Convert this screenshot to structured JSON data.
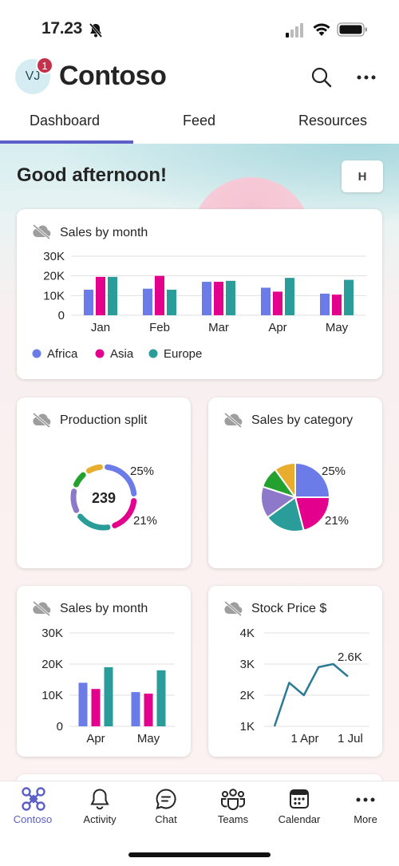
{
  "status_bar": {
    "time": "17.23"
  },
  "header": {
    "avatar_initials": "VJ",
    "badge_count": "1",
    "title": "Contoso"
  },
  "tabs": [
    {
      "label": "Dashboard",
      "selected": true
    },
    {
      "label": "Feed"
    },
    {
      "label": "Resources"
    }
  ],
  "greeting": "Good afternoon!",
  "hero_button_label": "H",
  "colors": {
    "accent": "#5b5fc7",
    "africa": "#6b7ce8",
    "asia": "#e3008c",
    "europe": "#2a9d9a",
    "line": "#2a7a94"
  },
  "cards": {
    "sales_month_big": {
      "title": "Sales by month"
    },
    "production_split": {
      "title": "Production split",
      "center_value": "239",
      "label_top": "25%",
      "label_bottom": "21%"
    },
    "sales_category": {
      "title": "Sales by category",
      "label_top": "25%",
      "label_bottom": "21%"
    },
    "sales_month_small": {
      "title": "Sales by month"
    },
    "stock_price": {
      "title": "Stock Price $",
      "annotation": "2.6K"
    }
  },
  "chart_data": [
    {
      "type": "bar",
      "title": "Sales by month",
      "categories": [
        "Jan",
        "Feb",
        "Mar",
        "Apr",
        "May"
      ],
      "series": [
        {
          "name": "Africa",
          "values": [
            13000,
            13500,
            17000,
            14000,
            11000
          ]
        },
        {
          "name": "Asia",
          "values": [
            19500,
            20000,
            17000,
            12000,
            10500
          ]
        },
        {
          "name": "Europe",
          "values": [
            19500,
            13000,
            17500,
            19000,
            18000
          ]
        }
      ],
      "yticks": [
        "0",
        "10K",
        "20K",
        "30K"
      ],
      "ylim": [
        0,
        30000
      ],
      "legend": "bottom-left"
    },
    {
      "type": "pie",
      "title": "Production split",
      "style": "donut",
      "center_label": "239",
      "slices": [
        {
          "value": 25,
          "color": "#6b7ce8",
          "label": "25%"
        },
        {
          "value": 21,
          "color": "#e3008c",
          "label": "21%"
        },
        {
          "value": 20,
          "color": "#2a9d9a"
        },
        {
          "value": 14,
          "color": "#8e78c9"
        },
        {
          "value": 10,
          "color": "#23a12e"
        },
        {
          "value": 10,
          "color": "#e8ad2e"
        }
      ]
    },
    {
      "type": "pie",
      "title": "Sales by category",
      "slices": [
        {
          "value": 25,
          "color": "#6b7ce8",
          "label": "25%"
        },
        {
          "value": 21,
          "color": "#e3008c",
          "label": "21%"
        },
        {
          "value": 19,
          "color": "#2a9d9a"
        },
        {
          "value": 15,
          "color": "#8e78c9"
        },
        {
          "value": 10,
          "color": "#23a12e"
        },
        {
          "value": 10,
          "color": "#e8ad2e"
        }
      ]
    },
    {
      "type": "bar",
      "title": "Sales by month",
      "categories": [
        "Apr",
        "May"
      ],
      "series": [
        {
          "name": "Africa",
          "values": [
            14000,
            11000
          ]
        },
        {
          "name": "Asia",
          "values": [
            12000,
            10500
          ]
        },
        {
          "name": "Europe",
          "values": [
            19000,
            18000
          ]
        }
      ],
      "yticks": [
        "0",
        "10K",
        "20K",
        "30K"
      ],
      "ylim": [
        0,
        30000
      ]
    },
    {
      "type": "line",
      "title": "Stock Price $",
      "y": [
        1000,
        2400,
        2000,
        2900,
        3000,
        2600
      ],
      "xticks": [
        "1 Apr",
        "1 Jul"
      ],
      "yticks": [
        "1K",
        "2K",
        "3K",
        "4K"
      ],
      "ylim": [
        1000,
        4000
      ],
      "annotation": "2.6K"
    }
  ],
  "bottom_nav": [
    {
      "label": "Contoso",
      "icon": "contoso-app-icon",
      "selected": true
    },
    {
      "label": "Activity",
      "icon": "bell-icon"
    },
    {
      "label": "Chat",
      "icon": "chat-icon"
    },
    {
      "label": "Teams",
      "icon": "teams-icon"
    },
    {
      "label": "Calendar",
      "icon": "calendar-icon"
    },
    {
      "label": "More",
      "icon": "more-icon"
    }
  ]
}
